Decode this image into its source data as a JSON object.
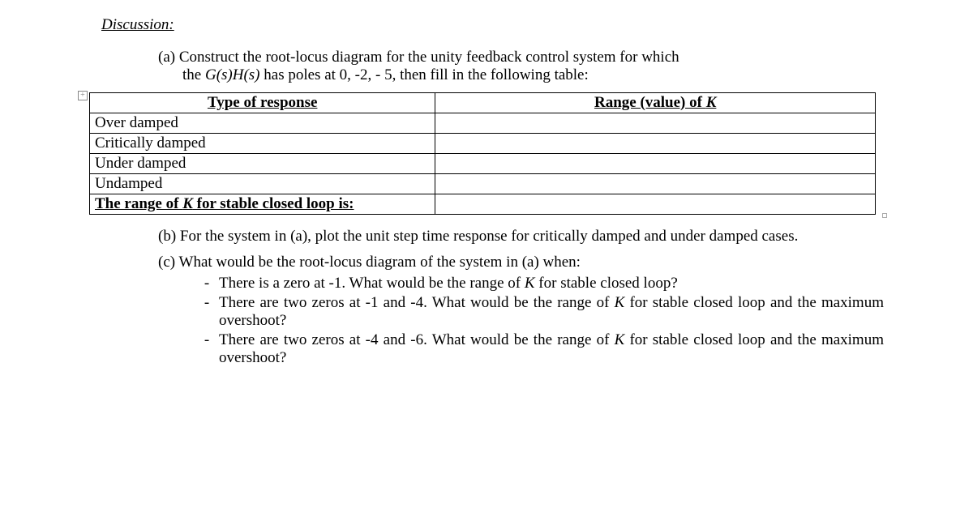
{
  "section_title": "Discussion:",
  "parts": {
    "a": {
      "label": "(a)",
      "line1": "Construct the root-locus diagram for the unity feedback control system for which",
      "line2_prefix": "the ",
      "line2_expr": "G(s)H(s)",
      "line2_suffix": " has poles at 0, -2, - 5, then fill in the following table:"
    },
    "b": {
      "label": "(b)",
      "text": "For the system in (a), plot the unit step time response for critically damped and under damped cases."
    },
    "c": {
      "label": "(c)",
      "text": "What would be the root-locus diagram of the system in (a) when:",
      "bullets": [
        {
          "pre": "There is a zero at -1. What would be the range of ",
          "K": "K",
          "post": " for stable closed loop?"
        },
        {
          "pre": "There are two zeros at -1 and -4. What would be the range of ",
          "K": "K",
          "post": " for stable closed loop and the maximum overshoot?"
        },
        {
          "pre": "There are two zeros at -4 and -6. What would be the range of ",
          "K": "K",
          "post": " for stable closed loop and the maximum overshoot?"
        }
      ]
    }
  },
  "table": {
    "header_left": "Type of response",
    "header_right_pre": "Range (value) of ",
    "header_right_K": "K",
    "rows": [
      {
        "label": "Over damped",
        "value": ""
      },
      {
        "label": "Critically damped",
        "value": ""
      },
      {
        "label": "Under damped",
        "value": ""
      },
      {
        "label": "Undamped",
        "value": ""
      }
    ],
    "stable_row_pre": "The range of ",
    "stable_row_K": "K",
    "stable_row_post": " for stable closed loop is:"
  },
  "anchor_glyph": "+"
}
